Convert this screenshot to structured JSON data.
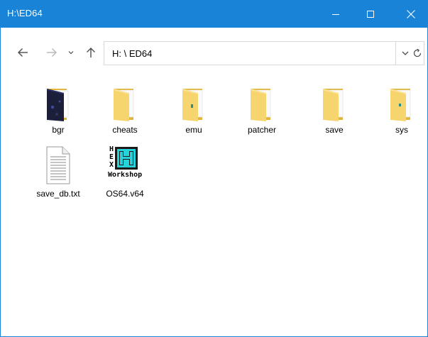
{
  "window": {
    "title": "H:\\ED64",
    "accent_color": "#1883d7"
  },
  "caption_buttons": {
    "minimize_icon": "minimize-icon",
    "maximize_icon": "maximize-icon",
    "close_icon": "close-icon"
  },
  "nav": {
    "back_icon": "arrow-left-icon",
    "forward_icon": "arrow-right-icon",
    "recent_icon": "chevron-down-icon",
    "up_icon": "arrow-up-icon"
  },
  "address": {
    "path": "H: \\ ED64",
    "dropdown_icon": "chevron-down-icon",
    "refresh_icon": "refresh-icon"
  },
  "items": [
    {
      "name": "bgr",
      "type": "folder",
      "icon": "folder-dark-icon"
    },
    {
      "name": "cheats",
      "type": "folder",
      "icon": "folder-icon"
    },
    {
      "name": "emu",
      "type": "folder",
      "icon": "folder-icon"
    },
    {
      "name": "patcher",
      "type": "folder",
      "icon": "folder-icon"
    },
    {
      "name": "save",
      "type": "folder",
      "icon": "folder-icon"
    },
    {
      "name": "sys",
      "type": "folder",
      "icon": "folder-icon"
    },
    {
      "name": "save_db.txt",
      "type": "file",
      "icon": "text-file-icon"
    },
    {
      "name": "OS64.v64",
      "type": "file",
      "icon": "hex-workshop-icon",
      "icon_text": [
        "H",
        "E",
        "X",
        "Workshop"
      ]
    }
  ]
}
